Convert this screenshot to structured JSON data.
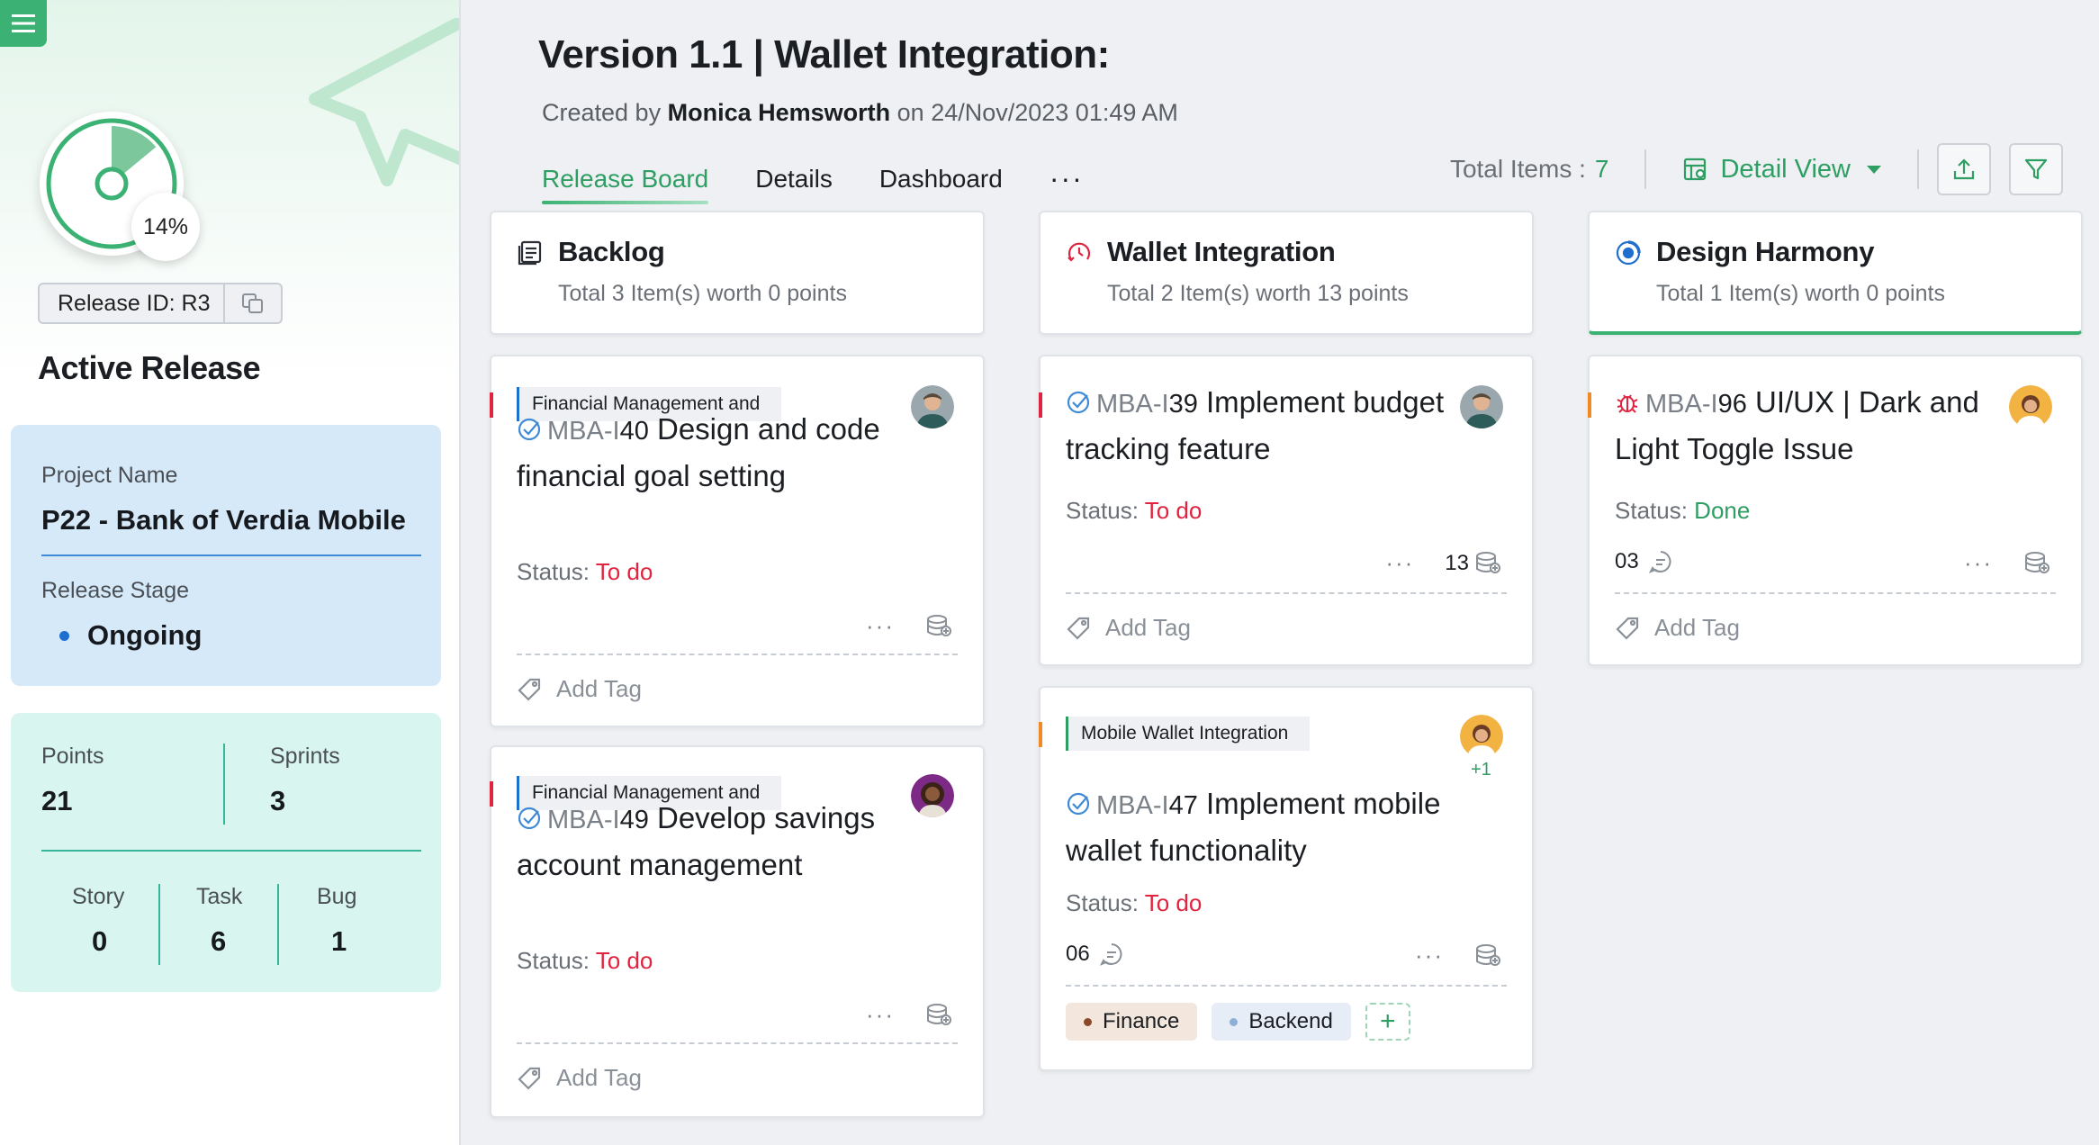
{
  "sidebar": {
    "progress_percent": 14,
    "progress_label": "14%",
    "release_id": "Release ID: R3",
    "heading": "Active Release",
    "project_name_label": "Project Name",
    "project_name": "P22 - Bank of Verdia Mobile",
    "release_stage_label": "Release Stage",
    "release_stage": "Ongoing",
    "points_label": "Points",
    "points": "21",
    "sprints_label": "Sprints",
    "sprints": "3",
    "story_label": "Story",
    "story": "0",
    "task_label": "Task",
    "task": "6",
    "bug_label": "Bug",
    "bug": "1"
  },
  "header": {
    "title": "Version 1.1 |  Wallet Integration:",
    "created_prefix": "Created by",
    "author": "Monica Hemsworth",
    "created_suffix": "on 24/Nov/2023 01:49 AM",
    "tabs": [
      {
        "label": "Release Board",
        "active": true
      },
      {
        "label": "Details",
        "active": false
      },
      {
        "label": "Dashboard",
        "active": false
      }
    ],
    "more": "···",
    "total_items_label": "Total Items :",
    "total_items": "7",
    "view_label": "Detail View"
  },
  "colors": {
    "accent": "#2e9e63",
    "todo": "#e0243f",
    "priority_high": "#e0243f",
    "priority_medium": "#f08a24"
  },
  "columns": [
    {
      "title": "Backlog",
      "summary": "Total 3 Item(s) worth 0 points",
      "icon": "backlog-icon",
      "cards": [
        {
          "epic": "Financial Management and",
          "key_prefix": "MBA-I",
          "key_num": "40",
          "title": "Design and code financial goal setting",
          "status_label": "Status:",
          "status": "To do",
          "add_tag": "Add Tag",
          "icon": "task-check-icon"
        },
        {
          "epic": "Financial Management and",
          "key_prefix": "MBA-I",
          "key_num": "49",
          "title": "Develop savings account management",
          "status_label": "Status:",
          "status": "To do",
          "add_tag": "Add Tag",
          "icon": "task-check-icon"
        }
      ]
    },
    {
      "title": "Wallet Integration",
      "summary": "Total 2 Item(s) worth 13 points",
      "icon": "sprint-clock-icon",
      "cards": [
        {
          "key_prefix": "MBA-I",
          "key_num": "39",
          "title": "Implement budget tracking feature",
          "status_label": "Status:",
          "status": "To do",
          "points": "13",
          "add_tag": "Add Tag",
          "icon": "task-check-icon"
        },
        {
          "epic": "Mobile Wallet Integration",
          "key_prefix": "MBA-I",
          "key_num": "47",
          "title": "Implement mobile wallet functionality",
          "status_label": "Status:",
          "status": "To do",
          "comments": "06",
          "extra_assignees": "+1",
          "tags": [
            "Finance",
            "Backend"
          ],
          "add_tag_button": "+",
          "icon": "task-check-icon"
        }
      ]
    },
    {
      "title": "Design Harmony",
      "summary": "Total 1 Item(s) worth 0 points",
      "icon": "sprint-target-icon",
      "cards": [
        {
          "key_prefix": "MBA-I",
          "key_num": "96",
          "title": "UI/UX | Dark and Light Toggle Issue",
          "status_label": "Status:",
          "status": "Done",
          "comments": "03",
          "add_tag": "Add Tag",
          "icon": "bug-icon"
        }
      ]
    }
  ]
}
